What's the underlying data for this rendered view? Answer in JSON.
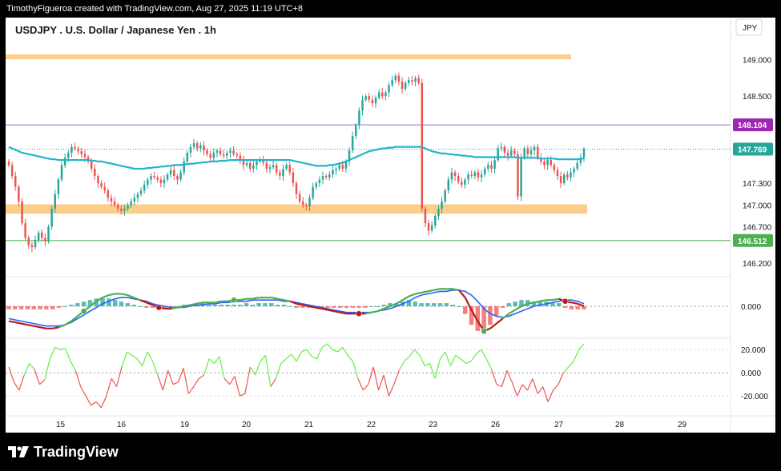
{
  "header": {
    "attribution": "TimothyFigueroa created with TradingView.com, Aug 27, 2025 11:19 UTC+8"
  },
  "footer": {
    "brand": "TradingView"
  },
  "colors": {
    "up": "#26a69a",
    "down": "#ef5350",
    "ma": "#22b5c9",
    "zone": "#fbcf8b",
    "resistance_line": "#9c6ddb",
    "support_line": "#4caf50",
    "macd_fast": "#4caf50",
    "macd_slow": "#2962ff",
    "macd_down": "#b71c1c",
    "osc_up": "#66ee44",
    "osc_down": "#ef5350"
  },
  "chart_data": {
    "type": "candlestick",
    "title": "USDJPY . U.S. Dollar / Japanese Yen . 1h",
    "currency": "JPY",
    "price_axis": {
      "ticks": [
        "149.000",
        "148.500",
        "147.300",
        "147.000",
        "146.700",
        "146.200"
      ],
      "price_labels": [
        {
          "label": "148.104",
          "role": "resistance"
        },
        {
          "label": "147.769",
          "role": "last"
        },
        {
          "label": "146.512",
          "role": "support"
        }
      ],
      "range": [
        146.08,
        149.25
      ]
    },
    "time_axis": {
      "labels": [
        "15",
        "16",
        "19",
        "20",
        "21",
        "22",
        "23",
        "26",
        "27",
        "28",
        "29"
      ]
    },
    "levels": {
      "upper_zone": 149.04,
      "resistance": 148.104,
      "last_price": 147.769,
      "support_zone": [
        146.88,
        147.01
      ],
      "support": 146.512
    },
    "candle_closes": [
      147.55,
      147.4,
      147.25,
      147.05,
      146.75,
      146.55,
      146.45,
      146.42,
      146.52,
      146.62,
      146.55,
      146.5,
      146.7,
      146.95,
      147.15,
      147.35,
      147.55,
      147.65,
      147.72,
      147.8,
      147.78,
      147.74,
      147.7,
      147.66,
      147.6,
      147.5,
      147.4,
      147.3,
      147.25,
      147.2,
      147.1,
      147.05,
      147.0,
      146.95,
      146.92,
      146.95,
      147.0,
      147.05,
      147.1,
      147.15,
      147.2,
      147.28,
      147.35,
      147.4,
      147.38,
      147.35,
      147.3,
      147.35,
      147.42,
      147.48,
      147.4,
      147.35,
      147.45,
      147.6,
      147.72,
      147.8,
      147.85,
      147.78,
      147.82,
      147.75,
      147.7,
      147.65,
      147.72,
      147.75,
      147.7,
      147.68,
      147.72,
      147.75,
      147.7,
      147.68,
      147.62,
      147.55,
      147.58,
      147.5,
      147.55,
      147.6,
      147.62,
      147.58,
      147.5,
      147.52,
      147.55,
      147.45,
      147.4,
      147.5,
      147.55,
      147.45,
      147.3,
      147.15,
      147.05,
      147.0,
      146.98,
      147.1,
      147.25,
      147.3,
      147.35,
      147.4,
      147.38,
      147.42,
      147.48,
      147.5,
      147.55,
      147.5,
      147.6,
      147.75,
      147.95,
      148.1,
      148.3,
      148.45,
      148.5,
      148.45,
      148.4,
      148.48,
      148.55,
      148.5,
      148.55,
      148.65,
      148.72,
      148.78,
      148.7,
      148.6,
      148.68,
      148.72,
      148.7,
      148.75,
      148.68,
      146.95,
      146.75,
      146.65,
      146.72,
      146.85,
      146.95,
      147.05,
      147.2,
      147.35,
      147.45,
      147.4,
      147.32,
      147.28,
      147.35,
      147.42,
      147.4,
      147.45,
      147.38,
      147.42,
      147.5,
      147.55,
      147.5,
      147.62,
      147.78,
      147.8,
      147.72,
      147.68,
      147.75,
      147.7,
      147.12,
      147.65,
      147.78,
      147.7,
      147.75,
      147.8,
      147.65,
      147.6,
      147.55,
      147.62,
      147.55,
      147.48,
      147.4,
      147.3,
      147.42,
      147.38,
      147.45,
      147.5,
      147.58,
      147.65,
      147.769
    ],
    "ma_values": [
      147.8,
      147.78,
      147.76,
      147.74,
      147.72,
      147.71,
      147.7,
      147.69,
      147.68,
      147.67,
      147.66,
      147.65,
      147.64,
      147.63,
      147.63,
      147.62,
      147.62,
      147.62,
      147.62,
      147.62,
      147.62,
      147.62,
      147.62,
      147.62,
      147.62,
      147.61,
      147.61,
      147.6,
      147.6,
      147.59,
      147.58,
      147.57,
      147.56,
      147.55,
      147.54,
      147.53,
      147.52,
      147.51,
      147.5,
      147.5,
      147.5,
      147.5,
      147.51,
      147.51,
      147.52,
      147.52,
      147.53,
      147.53,
      147.54,
      147.54,
      147.55,
      147.55,
      147.55,
      147.56,
      147.56,
      147.57,
      147.57,
      147.58,
      147.58,
      147.59,
      147.59,
      147.6,
      147.6,
      147.6,
      147.61,
      147.61,
      147.61,
      147.62,
      147.62,
      147.62,
      147.62,
      147.62,
      147.62,
      147.62,
      147.62,
      147.62,
      147.62,
      147.62,
      147.62,
      147.62,
      147.62,
      147.62,
      147.62,
      147.62,
      147.62,
      147.62,
      147.61,
      147.6,
      147.59,
      147.58,
      147.57,
      147.56,
      147.55,
      147.54,
      147.54,
      147.54,
      147.54,
      147.55,
      147.55,
      147.56,
      147.57,
      147.58,
      147.6,
      147.62,
      147.64,
      147.66,
      147.68,
      147.7,
      147.72,
      147.74,
      147.75,
      147.76,
      147.77,
      147.78,
      147.78,
      147.79,
      147.79,
      147.8,
      147.8,
      147.8,
      147.8,
      147.8,
      147.8,
      147.8,
      147.8,
      147.8,
      147.78,
      147.76,
      147.74,
      147.73,
      147.72,
      147.71,
      147.71,
      147.7,
      147.7,
      147.69,
      147.69,
      147.68,
      147.68,
      147.67,
      147.67,
      147.66,
      147.66,
      147.66,
      147.66,
      147.66,
      147.66,
      147.66,
      147.66,
      147.66,
      147.66,
      147.66,
      147.66,
      147.66,
      147.65,
      147.65,
      147.65,
      147.65,
      147.65,
      147.65,
      147.65,
      147.64,
      147.64,
      147.64,
      147.64,
      147.64,
      147.63,
      147.63,
      147.63,
      147.63,
      147.63,
      147.63,
      147.63,
      147.64,
      147.64
    ],
    "macd": {
      "axis_ticks": [
        "0.000"
      ],
      "range": [
        -0.22,
        0.2
      ],
      "fast": [
        -0.12,
        -0.13,
        -0.14,
        -0.15,
        -0.16,
        -0.17,
        -0.18,
        -0.18,
        -0.17,
        -0.15,
        -0.12,
        -0.08,
        -0.04,
        0.0,
        0.04,
        0.07,
        0.09,
        0.1,
        0.1,
        0.09,
        0.07,
        0.05,
        0.03,
        0.01,
        -0.01,
        -0.02,
        -0.02,
        -0.01,
        0.0,
        0.01,
        0.02,
        0.03,
        0.03,
        0.03,
        0.04,
        0.04,
        0.05,
        0.05,
        0.06,
        0.06,
        0.07,
        0.07,
        0.07,
        0.06,
        0.05,
        0.04,
        0.02,
        0.01,
        0.0,
        -0.01,
        -0.02,
        -0.03,
        -0.04,
        -0.05,
        -0.06,
        -0.06,
        -0.06,
        -0.06,
        -0.05,
        -0.04,
        -0.02,
        0.0,
        0.02,
        0.05,
        0.08,
        0.1,
        0.11,
        0.12,
        0.13,
        0.14,
        0.14,
        0.14,
        0.13,
        0.07,
        -0.03,
        -0.12,
        -0.2,
        -0.18,
        -0.14,
        -0.1,
        -0.06,
        -0.03,
        0.0,
        0.02,
        0.03,
        0.04,
        0.05,
        0.05,
        0.06,
        0.04,
        0.03,
        0.02,
        0.0
      ],
      "slow": [
        -0.1,
        -0.11,
        -0.12,
        -0.13,
        -0.14,
        -0.15,
        -0.16,
        -0.16,
        -0.16,
        -0.15,
        -0.13,
        -0.1,
        -0.07,
        -0.04,
        -0.01,
        0.02,
        0.04,
        0.06,
        0.07,
        0.07,
        0.06,
        0.05,
        0.04,
        0.02,
        0.01,
        0.0,
        -0.01,
        -0.01,
        -0.01,
        0.0,
        0.01,
        0.01,
        0.02,
        0.02,
        0.03,
        0.03,
        0.04,
        0.04,
        0.04,
        0.05,
        0.05,
        0.05,
        0.05,
        0.05,
        0.04,
        0.04,
        0.03,
        0.02,
        0.01,
        0.0,
        -0.01,
        -0.02,
        -0.03,
        -0.04,
        -0.05,
        -0.05,
        -0.05,
        -0.05,
        -0.05,
        -0.04,
        -0.03,
        -0.02,
        0.0,
        0.02,
        0.04,
        0.07,
        0.09,
        0.1,
        0.11,
        0.12,
        0.12,
        0.13,
        0.13,
        0.12,
        0.09,
        0.04,
        -0.02,
        -0.06,
        -0.08,
        -0.09,
        -0.08,
        -0.06,
        -0.04,
        -0.02,
        0.0,
        0.01,
        0.02,
        0.03,
        0.04,
        0.05,
        0.05,
        0.04,
        0.02
      ],
      "cross_indices": [
        12,
        24,
        36,
        56,
        76,
        89
      ],
      "cross_colors": [
        "green",
        "red",
        "green",
        "red",
        "green",
        "red"
      ]
    },
    "oscillator": {
      "axis_ticks": [
        "20.000",
        "0.000",
        "-20.000"
      ],
      "range": [
        -35,
        27
      ],
      "values": [
        5,
        -8,
        -15,
        -2,
        8,
        3,
        -10,
        -6,
        12,
        22,
        20,
        21,
        10,
        2,
        -12,
        -20,
        -28,
        -25,
        -30,
        -20,
        -5,
        -12,
        5,
        18,
        15,
        12,
        6,
        18,
        10,
        -2,
        -15,
        2,
        -10,
        -8,
        4,
        -18,
        -12,
        -5,
        -2,
        12,
        8,
        14,
        -5,
        -10,
        -3,
        -20,
        -18,
        5,
        -2,
        10,
        15,
        -12,
        -5,
        8,
        12,
        16,
        10,
        18,
        20,
        14,
        12,
        22,
        25,
        20,
        18,
        22,
        15,
        10,
        -5,
        -15,
        -10,
        5,
        -15,
        -2,
        -20,
        -10,
        2,
        10,
        14,
        20,
        15,
        6,
        8,
        -5,
        12,
        18,
        6,
        15,
        12,
        8,
        10,
        16,
        20,
        12,
        3,
        -10,
        -12,
        2,
        -8,
        -20,
        -10,
        -15,
        -5,
        -18,
        -12,
        -25,
        -15,
        -10,
        0,
        5,
        10,
        20,
        25
      ]
    }
  }
}
